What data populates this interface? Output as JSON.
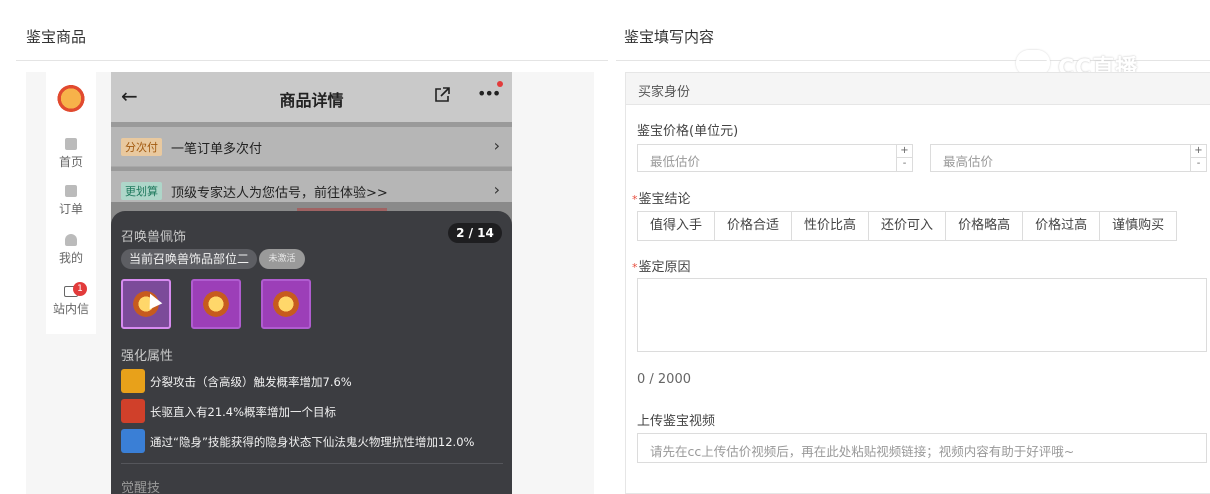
{
  "left_pane": {
    "title": "鉴宝商品"
  },
  "right_pane": {
    "title": "鉴宝填写内容"
  },
  "watermark": {
    "text": "CC直播"
  },
  "side_nav": {
    "items": [
      {
        "label": "首页",
        "icon": "home-icon"
      },
      {
        "label": "订单",
        "icon": "order-icon"
      },
      {
        "label": "我的",
        "icon": "person-icon"
      },
      {
        "label": "站内信",
        "icon": "mail-icon",
        "badge": "1"
      }
    ]
  },
  "phone": {
    "title": "商品详情",
    "rows": [
      {
        "tag": "分次付",
        "text": "一笔订单多次付"
      },
      {
        "tag": "更划算",
        "text": "顶级专家达人为您估号，前往体验>>"
      }
    ],
    "overlay": {
      "title": "召唤兽佩饰",
      "page": "2 / 14",
      "chip": "当前召唤兽饰品部位二",
      "chip_mark": "未激活",
      "section": "强化属性",
      "attributes": [
        {
          "text": "分裂攻击（含高级）触发概率增加7.6%",
          "color": "#e8a11a"
        },
        {
          "text": "长驱直入有21.4%概率增加一个目标",
          "color": "#d0402a"
        },
        {
          "text": "通过“隐身”技能获得的隐身状态下仙法鬼火物理抗性增加12.0%",
          "color": "#3a7fd6"
        }
      ],
      "section2": "觉醒技"
    }
  },
  "form": {
    "section_header": "买家身份",
    "price_label": "鉴宝价格(单位元)",
    "min_placeholder": "最低估价",
    "max_placeholder": "最高估价",
    "stepper_plus": "+",
    "stepper_minus": "-",
    "conclusion_label": "鉴宝结论",
    "conclusions": [
      "值得入手",
      "价格合适",
      "性价比高",
      "还价可入",
      "价格略高",
      "价格过高",
      "谨慎购买"
    ],
    "reason_label": "鉴定原因",
    "counter": "0 / 2000",
    "video_label": "上传鉴宝视频",
    "video_placeholder": "请先在cc上传估价视频后，再在此处粘贴视频链接；视频内容有助于好评哦~",
    "required_mark": "*"
  }
}
